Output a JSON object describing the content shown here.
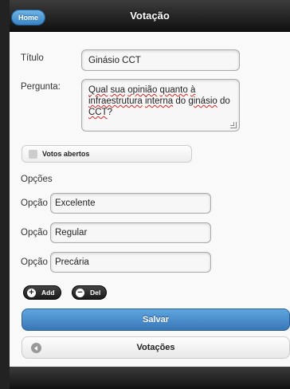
{
  "header": {
    "title": "Votação",
    "home_label": "Home"
  },
  "form": {
    "titulo_label": "Título",
    "titulo_value": "Ginásio CCT",
    "pergunta_label": "Pergunta:",
    "pergunta_parts": [
      "Qual",
      " ",
      "sua",
      " ",
      "opinião",
      " ",
      "quanto",
      " ",
      "à",
      " ",
      "infraestrutura",
      " ",
      "interna",
      " do ",
      "ginásio",
      " do ",
      "CCT",
      "?"
    ],
    "votos_abertos_label": "Votos abertos",
    "opcoes_heading": "Opções",
    "options": [
      {
        "label": "Opção",
        "value": "Excelente"
      },
      {
        "label": "Opção",
        "value": "Regular"
      },
      {
        "label": "Opção",
        "value": "Precária"
      }
    ]
  },
  "buttons": {
    "add_label": "Add",
    "del_label": "Del",
    "save_label": "Salvar",
    "votacoes_label": "Votações"
  },
  "colors": {
    "accent": "#3977b6",
    "header_bg": "#1a1a1a",
    "page_bg": "#f9f9f9"
  },
  "icons": {
    "add": "plus-icon",
    "del": "minus-icon",
    "back": "chevron-left-icon"
  }
}
